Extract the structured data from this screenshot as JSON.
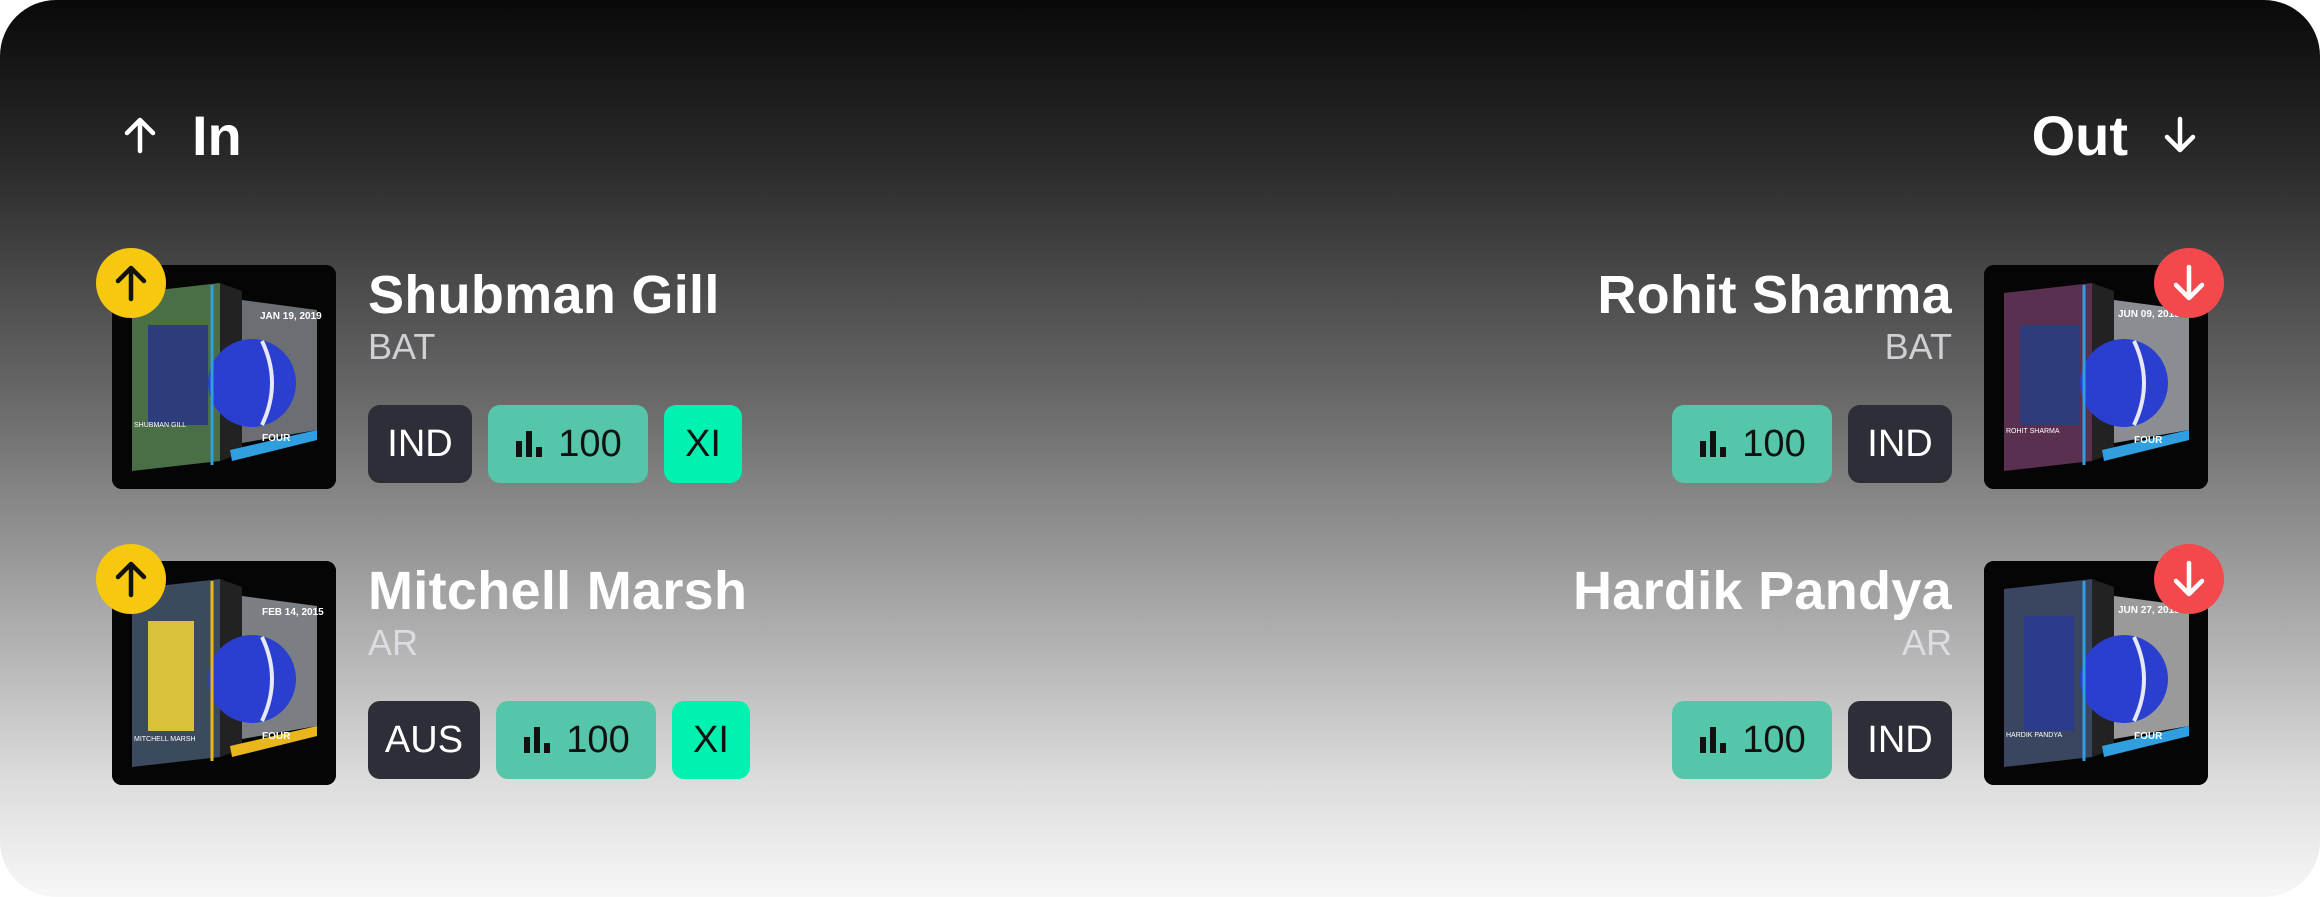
{
  "header": {
    "in_label": "In",
    "out_label": "Out"
  },
  "players_in": [
    {
      "name": "Shubman Gill",
      "role": "BAT",
      "team": "IND",
      "points": "100",
      "xi": "XI",
      "card": {
        "date": "JAN 19, 2019",
        "caption": "SHUBMAN GILL",
        "shot": "FOUR",
        "frame_color": "#2f9fe0"
      }
    },
    {
      "name": "Mitchell Marsh",
      "role": "AR",
      "team": "AUS",
      "points": "100",
      "xi": "XI",
      "card": {
        "date": "FEB 14, 2015",
        "caption": "MITCHELL MARSH",
        "shot": "FOUR",
        "frame_color": "#e9b61c"
      }
    }
  ],
  "players_out": [
    {
      "name": "Rohit Sharma",
      "role": "BAT",
      "team": "IND",
      "points": "100",
      "card": {
        "date": "JUN 09, 2019",
        "caption": "ROHIT SHARMA",
        "shot": "FOUR",
        "frame_color": "#2f9fe0"
      }
    },
    {
      "name": "Hardik Pandya",
      "role": "AR",
      "team": "IND",
      "points": "100",
      "card": {
        "date": "JUN 27, 2019",
        "caption": "HARDIK PANDYA",
        "shot": "FOUR",
        "frame_color": "#2f9fe0"
      }
    }
  ],
  "colors": {
    "in_badge": "#f6c90e",
    "out_badge": "#f3494c",
    "points_chip": "#55c6a9",
    "xi_chip": "#00f2b0",
    "team_chip": "#2e2e38",
    "role_bat": "#cfcfd4",
    "role_ar": "#dcdce2"
  },
  "icons": {
    "in": "arrow-up-icon",
    "out": "arrow-down-icon",
    "points": "bar-chart-icon"
  }
}
